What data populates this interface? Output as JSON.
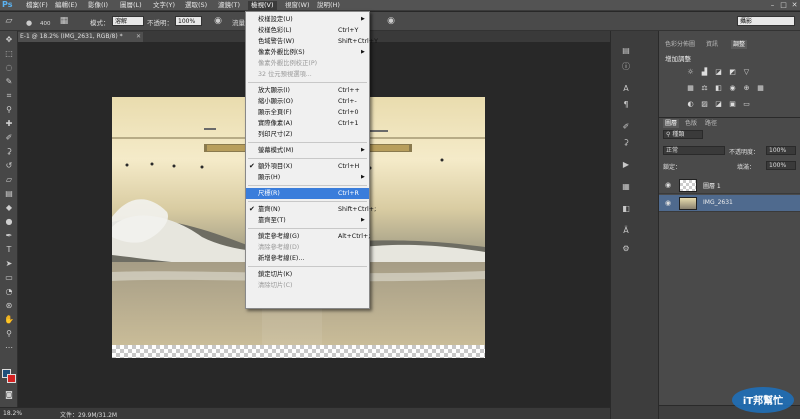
{
  "app": {
    "logo": "Ps"
  },
  "menubar": {
    "items": [
      "檔案(F)",
      "編輯(E)",
      "影像(I)",
      "圖層(L)",
      "文字(Y)",
      "選取(S)",
      "濾鏡(T)",
      "檢視(V)",
      "視窗(W)",
      "說明(H)"
    ],
    "active": "檢視(V)",
    "window_controls": [
      "–",
      "□",
      "✕"
    ]
  },
  "options": {
    "brush_size": "400",
    "mode_label": "模式：",
    "mode_value": "溶解",
    "opacity_label": "不透明：",
    "opacity_value": "100%",
    "flow_label": "流量",
    "workspace_value": "攝影"
  },
  "document": {
    "tab_title": "E-1 @ 18.2% (IMG_2631, RGB/8) *",
    "close_icon": "✕"
  },
  "status": {
    "zoom": "18.2%",
    "file_info": "文件：29.9M/31.2M"
  },
  "view_menu": {
    "items": [
      {
        "label": "校樣設定(U)",
        "shortcut": "",
        "submenu": true
      },
      {
        "label": "校樣色彩(L)",
        "shortcut": "Ctrl+Y"
      },
      {
        "label": "色域警告(W)",
        "shortcut": "Shift+Ctrl+Y"
      },
      {
        "label": "像素外觀比例(S)",
        "shortcut": "",
        "submenu": true
      },
      {
        "label": "像素外觀比例校正(P)",
        "shortcut": "",
        "disabled": true
      },
      {
        "label": "32 位元預視選項...",
        "shortcut": "",
        "disabled": true
      },
      {
        "sep": true
      },
      {
        "label": "放大顯示(I)",
        "shortcut": "Ctrl++"
      },
      {
        "label": "縮小顯示(O)",
        "shortcut": "Ctrl+-"
      },
      {
        "label": "顯示全頁(F)",
        "shortcut": "Ctrl+0"
      },
      {
        "label": "實際像素(A)",
        "shortcut": "Ctrl+1"
      },
      {
        "label": "列印尺寸(Z)",
        "shortcut": ""
      },
      {
        "sep": true
      },
      {
        "label": "螢幕模式(M)",
        "shortcut": "",
        "submenu": true
      },
      {
        "sep": true
      },
      {
        "label": "額外項目(X)",
        "shortcut": "Ctrl+H",
        "checked": true
      },
      {
        "label": "顯示(H)",
        "shortcut": "",
        "submenu": true
      },
      {
        "sep": true
      },
      {
        "label": "尺標(R)",
        "shortcut": "Ctrl+R",
        "highlighted": true
      },
      {
        "sep": true
      },
      {
        "label": "靠齊(N)",
        "shortcut": "Shift+Ctrl+;",
        "checked": true
      },
      {
        "label": "靠齊至(T)",
        "shortcut": "",
        "submenu": true
      },
      {
        "sep": true
      },
      {
        "label": "鎖定參考線(G)",
        "shortcut": "Alt+Ctrl+;"
      },
      {
        "label": "清除參考線(D)",
        "shortcut": "",
        "disabled": true
      },
      {
        "label": "新增參考線(E)...",
        "shortcut": ""
      },
      {
        "sep": true
      },
      {
        "label": "鎖定切片(K)",
        "shortcut": ""
      },
      {
        "label": "清除切片(C)",
        "shortcut": "",
        "disabled": true
      }
    ]
  },
  "panels": {
    "top_tabs": [
      "色彩分佈圖",
      "資訊",
      "調整"
    ],
    "active_top_tab": "調整",
    "adjust_title": "增加調整",
    "layer_tabs": [
      "圖層",
      "色版",
      "路徑"
    ],
    "active_layer_tab": "圖層",
    "kind_filter": "種類",
    "blend_mode": "正常",
    "opacity_label": "不透明度：",
    "opacity_value": "100%",
    "lock_label": "鎖定：",
    "fill_label": "填滿：",
    "fill_value": "100%",
    "layers": [
      {
        "name": "圖層 1",
        "selected": false
      },
      {
        "name": "IMG_2631",
        "selected": true
      }
    ]
  },
  "watermark": {
    "text": "iT邦幫忙"
  }
}
